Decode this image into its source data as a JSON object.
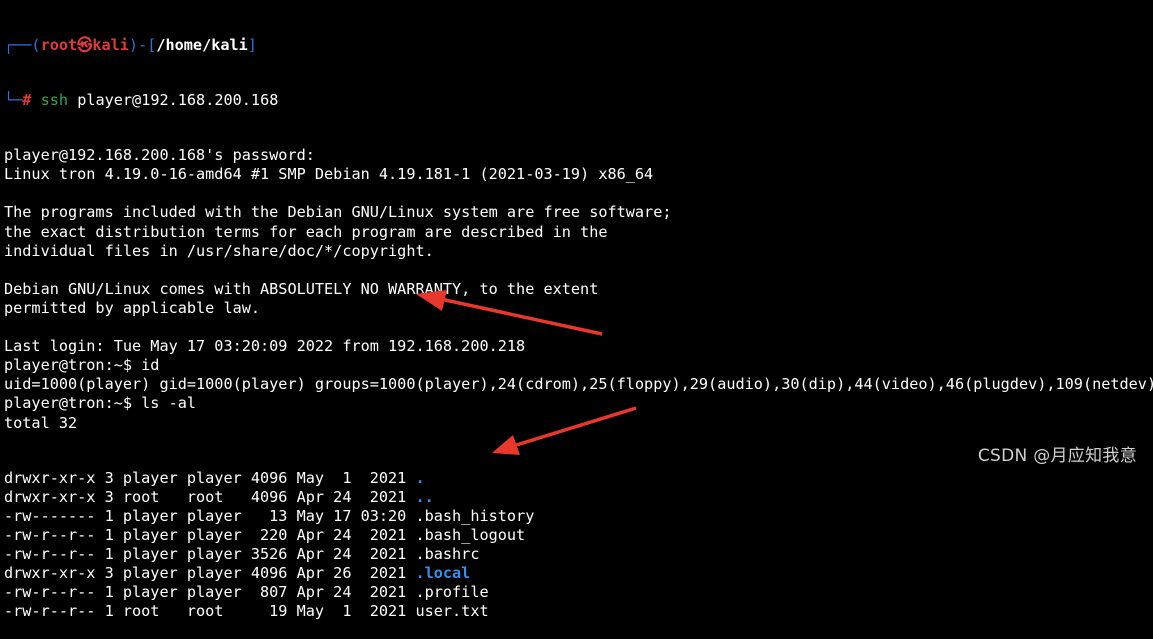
{
  "prompt": {
    "box_top_left": "┌──(",
    "user": "root",
    "skull": "💀",
    "host": "kali",
    "sep": ")-[",
    "path": "/home/kali",
    "close": "]",
    "box_bottom_left": "└─",
    "hash": "#",
    "command": "ssh",
    "args": " player@192.168.200.168"
  },
  "lines": [
    "player@192.168.200.168's password:",
    "Linux tron 4.19.0-16-amd64 #1 SMP Debian 4.19.181-1 (2021-03-19) x86_64",
    "",
    "The programs included with the Debian GNU/Linux system are free software;",
    "the exact distribution terms for each program are described in the",
    "individual files in /usr/share/doc/*/copyright.",
    "",
    "Debian GNU/Linux comes with ABSOLUTELY NO WARRANTY, to the extent",
    "permitted by applicable law.",
    "",
    "Last login: Tue May 17 03:20:09 2022 from 192.168.200.218",
    "player@tron:~$ id",
    "uid=1000(player) gid=1000(player) groups=1000(player),24(cdrom),25(floppy),29(audio),30(dip),44(video),46(plugdev),109(netdev)",
    "player@tron:~$ ls -al",
    "total 32"
  ],
  "listing": [
    {
      "meta": "drwxr-xr-x 3 player player 4096 May  1  2021 ",
      "name": ".",
      "dir": true
    },
    {
      "meta": "drwxr-xr-x 3 root   root   4096 Apr 24  2021 ",
      "name": "..",
      "dir": true
    },
    {
      "meta": "-rw------- 1 player player   13 May 17 03:20 ",
      "name": ".bash_history",
      "dir": false
    },
    {
      "meta": "-rw-r--r-- 1 player player  220 Apr 24  2021 ",
      "name": ".bash_logout",
      "dir": false
    },
    {
      "meta": "-rw-r--r-- 1 player player 3526 Apr 24  2021 ",
      "name": ".bashrc",
      "dir": false
    },
    {
      "meta": "drwxr-xr-x 3 player player 4096 Apr 26  2021 ",
      "name": ".local",
      "dir": true
    },
    {
      "meta": "-rw-r--r-- 1 player player  807 Apr 24  2021 ",
      "name": ".profile",
      "dir": false
    },
    {
      "meta": "-rw-r--r-- 1 root   root     19 May  1  2021 ",
      "name": "user.txt",
      "dir": false
    }
  ],
  "watermark": "CSDN @月应知我意",
  "colors": {
    "background": "#000000",
    "text": "#ffffff",
    "prompt_frame": "#2f6fd6",
    "prompt_user": "#e03b3b",
    "command": "#2fa84a",
    "directory": "#3b8eea",
    "arrow": "#e8372b"
  }
}
